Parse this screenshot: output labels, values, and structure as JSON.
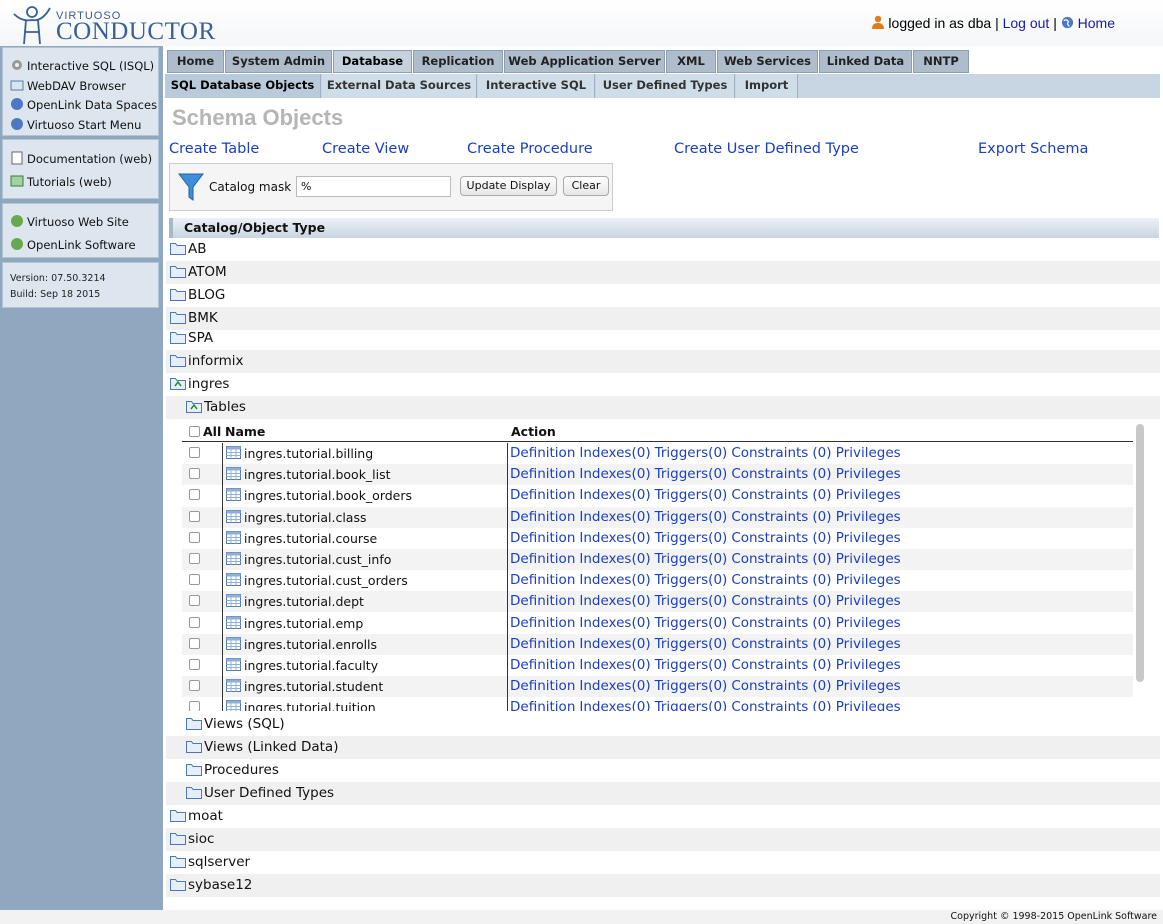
{
  "header": {
    "logo_small": "VIRTUOSO",
    "logo_big": "CONDUCTOR",
    "logged_in": "logged in as dba",
    "sep1": "|",
    "logout": "Log out",
    "sep2": "|",
    "home": "Home"
  },
  "sidebar": {
    "group1": [
      "Interactive SQL (ISQL)",
      "WebDAV Browser",
      "OpenLink Data Spaces",
      "Virtuoso Start Menu"
    ],
    "group2": [
      "Documentation (web)",
      "Tutorials (web)"
    ],
    "group3": [
      "Virtuoso Web Site",
      "OpenLink Software"
    ],
    "version": "Version: 07.50.3214",
    "build": "Build: Sep 18 2015"
  },
  "tabs": [
    "Home",
    "System Admin",
    "Database",
    "Replication",
    "Web Application Server",
    "XML",
    "Web Services",
    "Linked Data",
    "NNTP"
  ],
  "subtabs": [
    "SQL Database Objects",
    "External Data Sources",
    "Interactive SQL",
    "User Defined Types",
    "Import"
  ],
  "page_title": "Schema Objects",
  "create_links": [
    "Create Table",
    "Create View",
    "Create Procedure",
    "Create User Defined Type",
    "Export Schema"
  ],
  "mask": {
    "label": "Catalog mask",
    "value": "%",
    "update_btn": "Update Display",
    "clear_btn": "Clear"
  },
  "tree": {
    "header": "Catalog/Object Type",
    "catalogs_top": [
      "AB",
      "ATOM",
      "BLOG",
      "BMK",
      "SPA",
      "informix",
      "ingres"
    ],
    "tables_folder": "Tables",
    "table_headers": {
      "all": "All",
      "name": "Name",
      "action": "Action"
    },
    "tables": [
      "ingres.tutorial.billing",
      "ingres.tutorial.book_list",
      "ingres.tutorial.book_orders",
      "ingres.tutorial.class",
      "ingres.tutorial.course",
      "ingres.tutorial.cust_info",
      "ingres.tutorial.cust_orders",
      "ingres.tutorial.dept",
      "ingres.tutorial.emp",
      "ingres.tutorial.enrolls",
      "ingres.tutorial.faculty",
      "ingres.tutorial.student",
      "ingres.tutorial.tuition"
    ],
    "actions": [
      "Definition",
      "Indexes(0)",
      "Triggers(0)",
      "Constraints",
      "(0) Privileges"
    ],
    "sub_folders": [
      "Views (SQL)",
      "Views (Linked Data)",
      "Procedures",
      "User Defined Types"
    ],
    "catalogs_bottom": [
      "moat",
      "sioc",
      "sqlserver",
      "sybase12"
    ]
  },
  "footer": "Copyright © 1998-2015 OpenLink Software"
}
